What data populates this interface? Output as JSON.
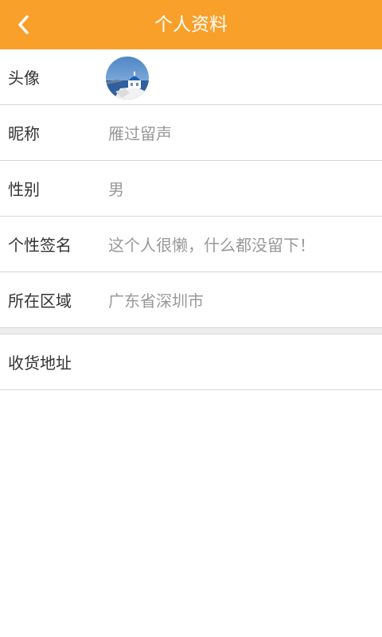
{
  "header": {
    "title": "个人资料",
    "back_icon": "chevron-left-icon"
  },
  "colors": {
    "header_bg": "#f9a02b",
    "label": "#333333",
    "value": "#999999"
  },
  "profile": {
    "avatar": {
      "label": "头像"
    },
    "nickname": {
      "label": "昵称",
      "value": "雁过留声"
    },
    "gender": {
      "label": "性别",
      "value": "男"
    },
    "signature": {
      "label": "个性签名",
      "value": "这个人很懒，什么都没留下！"
    },
    "region": {
      "label": "所在区域",
      "value": "广东省深圳市"
    }
  },
  "address": {
    "label": "收货地址"
  }
}
